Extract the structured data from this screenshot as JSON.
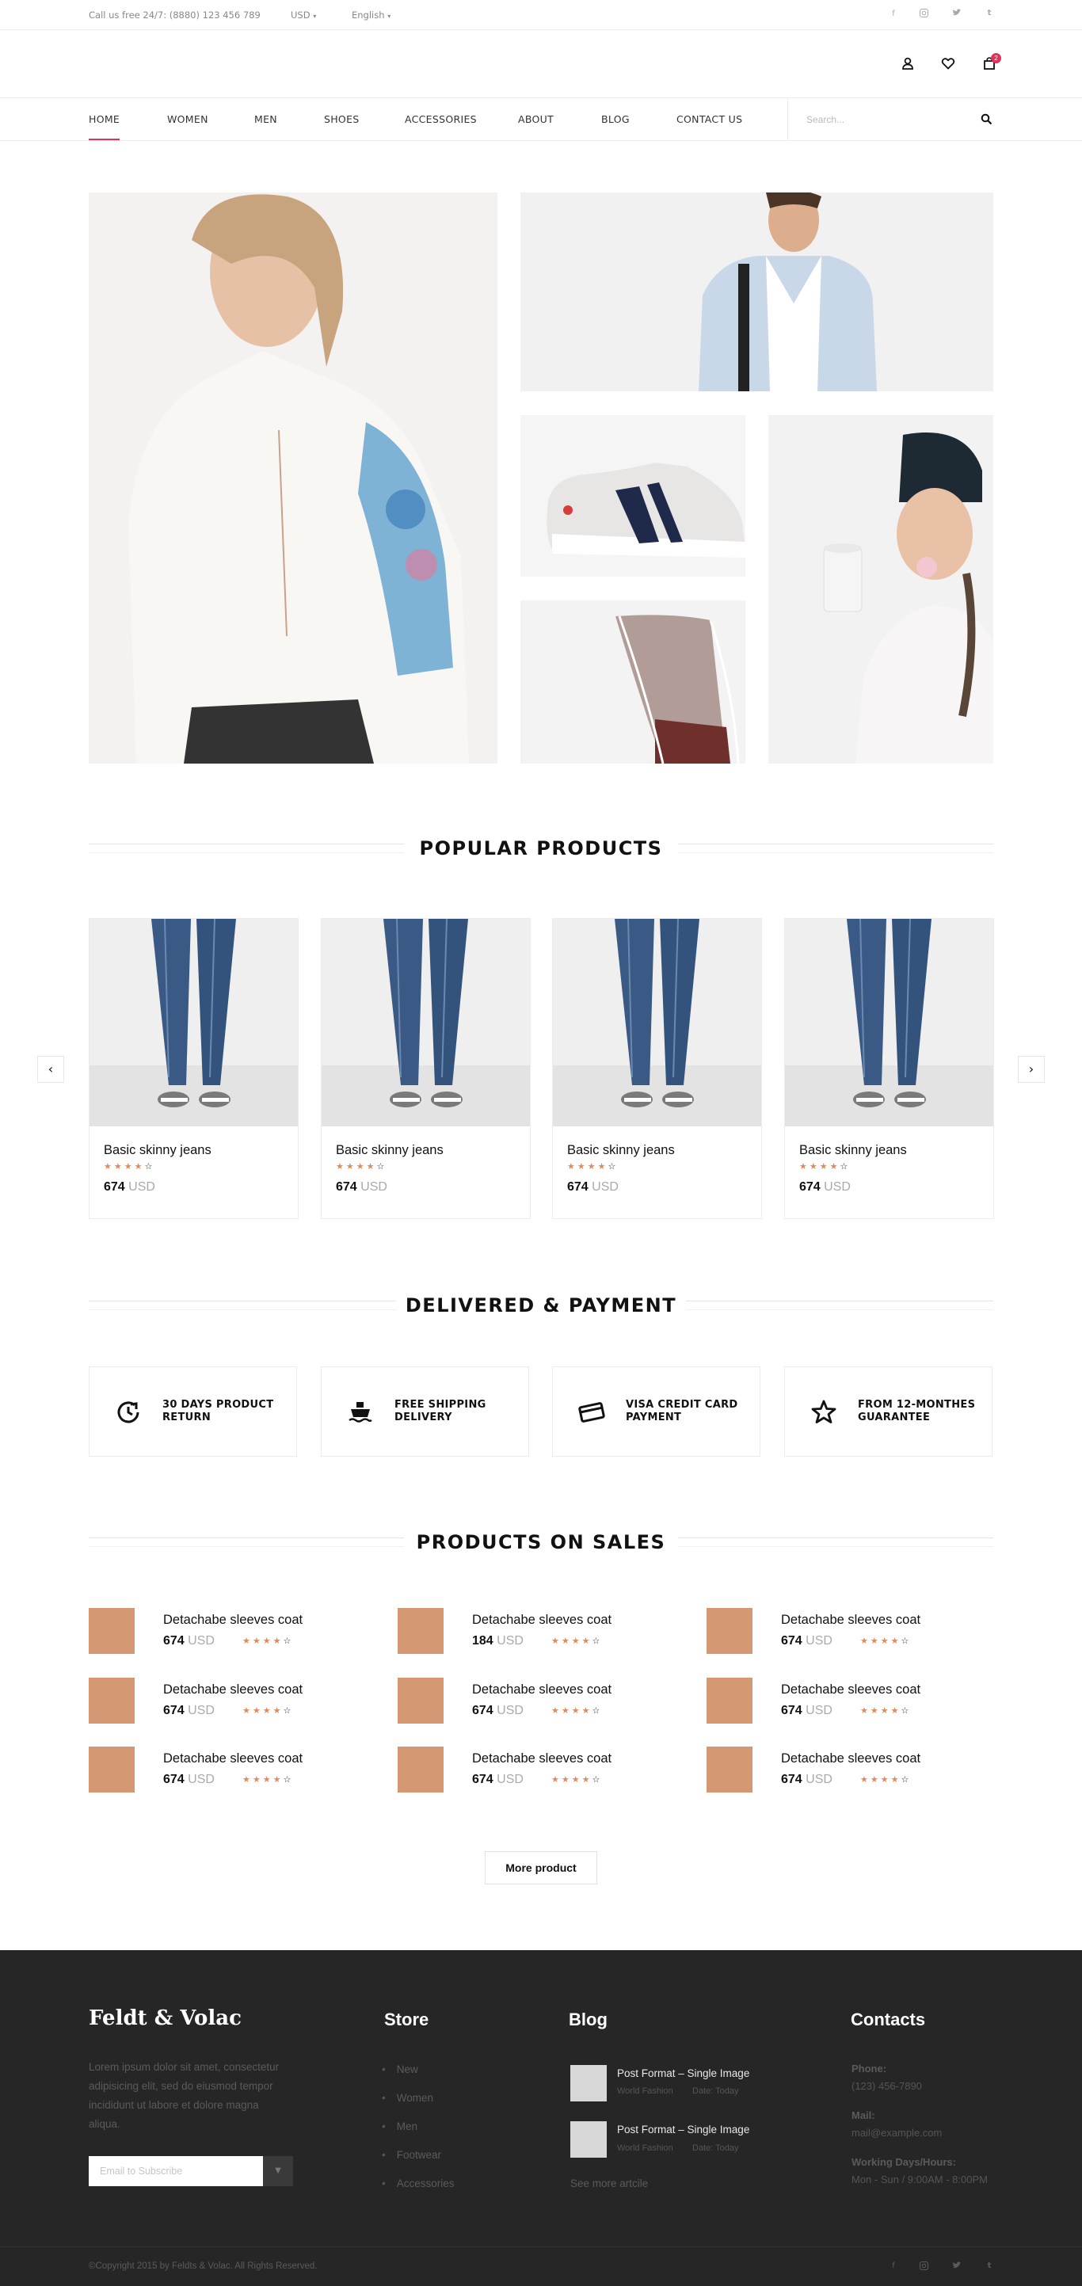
{
  "topbar": {
    "phone": "Call us free 24/7: (8880) 123 456 789",
    "currency": "USD",
    "language": "English",
    "social": [
      "facebook-icon",
      "instagram-icon",
      "twitter-icon",
      "tumblr-icon"
    ]
  },
  "header": {
    "icons": [
      "user-icon",
      "heart-icon",
      "bag-icon"
    ],
    "cart_count": "2"
  },
  "nav": {
    "items": [
      "HOME",
      "WOMEN",
      "MEN",
      "SHOES",
      "ACCESSORIES",
      "ABOUT",
      "BLOG",
      "CONTACT US"
    ],
    "active": "HOME",
    "search_placeholder": "Search..."
  },
  "popular": {
    "title": "POPULAR PRODUCTS",
    "products": [
      {
        "name": "Basic skinny jeans",
        "price": "674",
        "currency": "USD",
        "rating": 4
      },
      {
        "name": "Basic skinny jeans",
        "price": "674",
        "currency": "USD",
        "rating": 4
      },
      {
        "name": "Basic skinny jeans",
        "price": "674",
        "currency": "USD",
        "rating": 4
      },
      {
        "name": "Basic skinny jeans",
        "price": "674",
        "currency": "USD",
        "rating": 4
      }
    ]
  },
  "delivery": {
    "title": "DELIVERED & PAYMENT",
    "items": [
      {
        "line1": "30 DAYS PRODUCT",
        "line2": "RETURN",
        "icon": "return-icon"
      },
      {
        "line1": "FREE SHIPPING",
        "line2": "DELIVERY",
        "icon": "ship-icon"
      },
      {
        "line1": "VISA CREDIT CARD",
        "line2": "PAYMENT",
        "icon": "credit-card-icon"
      },
      {
        "line1": "FROM 12-MONTHES",
        "line2": "GUARANTEE",
        "icon": "star-icon"
      }
    ]
  },
  "sales": {
    "title": "PRODUCTS ON SALES",
    "items": [
      {
        "name": "Detachabe sleeves coat",
        "price": "674",
        "currency": "USD",
        "rating": 4
      },
      {
        "name": "Detachabe sleeves coat",
        "price": "184",
        "currency": "USD",
        "rating": 4
      },
      {
        "name": "Detachabe sleeves coat",
        "price": "674",
        "currency": "USD",
        "rating": 4
      },
      {
        "name": "Detachabe sleeves coat",
        "price": "674",
        "currency": "USD",
        "rating": 4
      },
      {
        "name": "Detachabe sleeves coat",
        "price": "674",
        "currency": "USD",
        "rating": 4
      },
      {
        "name": "Detachabe sleeves coat",
        "price": "674",
        "currency": "USD",
        "rating": 4
      },
      {
        "name": "Detachabe sleeves coat",
        "price": "674",
        "currency": "USD",
        "rating": 4
      },
      {
        "name": "Detachabe sleeves coat",
        "price": "674",
        "currency": "USD",
        "rating": 4
      },
      {
        "name": "Detachabe sleeves coat",
        "price": "674",
        "currency": "USD",
        "rating": 4
      }
    ],
    "thumb_color": "#d49872",
    "more_label": "More product"
  },
  "footer": {
    "brand": "Feldt & Volac",
    "about": [
      "Lorem ipsum dolor sit amet, consectetur",
      "adipisicing elit, sed do eiusmod tempor",
      "incididunt ut labore et dolore magna",
      "aliqua."
    ],
    "subscribe_placeholder": "Email to Subscribe",
    "store": {
      "title": "Store",
      "items": [
        "New",
        "Women",
        "Men",
        "Footwear",
        "Accessories"
      ]
    },
    "blog": {
      "title": "Blog",
      "posts": [
        {
          "title": "Post Format – Single Image",
          "category": "World Fashion",
          "date": "Date: Today"
        },
        {
          "title": "Post Format – Single Image",
          "category": "World Fashion",
          "date": "Date: Today"
        }
      ],
      "more": "See more artcile"
    },
    "contacts": {
      "title": "Contacts",
      "phone_label": "Phone:",
      "phone": "(123) 456-7890",
      "mail_label": "Mail:",
      "mail": "mail@example.com",
      "hours_label": "Working Days/Hours:",
      "hours": "Mon - Sun / 9:00AM - 8:00PM"
    },
    "copyright": "©Copyright 2015 by Feldts & Volac. All Rights Reserved."
  },
  "colors": {
    "accent": "#e0315a",
    "star": "#e08a5c",
    "footer_bg": "#262626"
  }
}
